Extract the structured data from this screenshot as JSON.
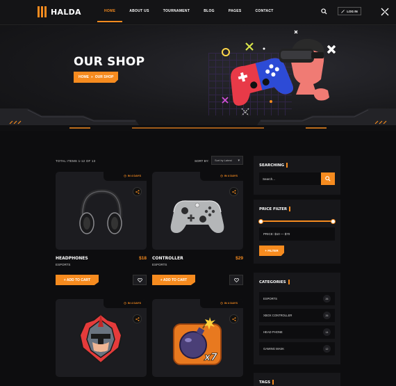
{
  "header": {
    "brand": "HALDA",
    "nav": [
      "HOME",
      "ABOUT US",
      "TOURNAMENT",
      "BLOG",
      "PAGES",
      "CONTACT"
    ],
    "active_nav": "HOME",
    "login_label": "LOG IN"
  },
  "hero": {
    "title": "OUR SHOP",
    "breadcrumb": [
      "HOME",
      "OUR SHOP"
    ]
  },
  "shop": {
    "results_text": "TOTAL ITEMS 1-12 OF 13",
    "sort_label": "SORT BY:",
    "sort_value": "Sort by Latest",
    "products": [
      {
        "name": "HEADPHONES",
        "category": "ESPORTS",
        "price": "$18",
        "badge": "IN 4 DAYS",
        "icon": "headphones-icon"
      },
      {
        "name": "CONTROLLER",
        "category": "ESPORTS",
        "price": "$29",
        "badge": "IN 4 DAYS",
        "icon": "gamepad-icon"
      },
      {
        "name": "",
        "category": "",
        "price": "",
        "badge": "IN 4 DAYS",
        "icon": "spartan-helmet-icon"
      },
      {
        "name": "",
        "category": "",
        "price": "",
        "badge": "IN 4 DAYS",
        "icon": "bomb-icon",
        "multiplier": "x7"
      }
    ],
    "add_to_cart_label": "+ ADD TO CART"
  },
  "sidebar": {
    "search": {
      "title": "SEARCHING",
      "placeholder": "Search..."
    },
    "price_filter": {
      "title": "PRICE FILTER",
      "price_text": "PRICE: $10 — $70",
      "button_label": "+ FILTER"
    },
    "categories": {
      "title": "CATEGORIES",
      "items": [
        {
          "label": "ESPORTS",
          "count": "26"
        },
        {
          "label": "XBOX CONTROLLER",
          "count": "26"
        },
        {
          "label": "HEAD PHONE",
          "count": "14"
        },
        {
          "label": "GAMING MASK",
          "count": "12"
        }
      ]
    },
    "tags": {
      "title": "TAGS"
    }
  },
  "colors": {
    "accent": "#f68b1f",
    "background": "#0d0d0f",
    "card": "#1c1c20"
  }
}
